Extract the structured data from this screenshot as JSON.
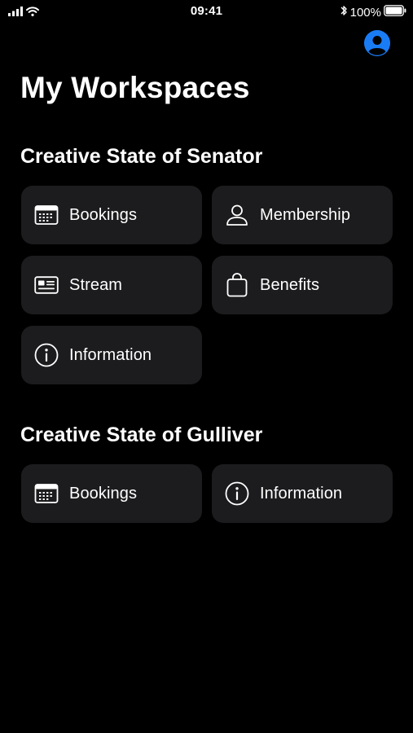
{
  "status_bar": {
    "time": "09:41",
    "battery": "100%"
  },
  "header": {
    "title": "My Workspaces",
    "profile_icon": "person-circle-icon",
    "accent_color": "#1a7cf5"
  },
  "sections": [
    {
      "title": "Creative State of Senator",
      "tiles": [
        {
          "label": "Bookings",
          "icon": "calendar-icon"
        },
        {
          "label": "Membership",
          "icon": "person-icon"
        },
        {
          "label": "Stream",
          "icon": "id-card-icon"
        },
        {
          "label": "Benefits",
          "icon": "bag-icon"
        },
        {
          "label": "Information",
          "icon": "info-icon"
        }
      ]
    },
    {
      "title": "Creative State of Gulliver",
      "tiles": [
        {
          "label": "Bookings",
          "icon": "calendar-icon"
        },
        {
          "label": "Information",
          "icon": "info-icon"
        }
      ]
    }
  ]
}
